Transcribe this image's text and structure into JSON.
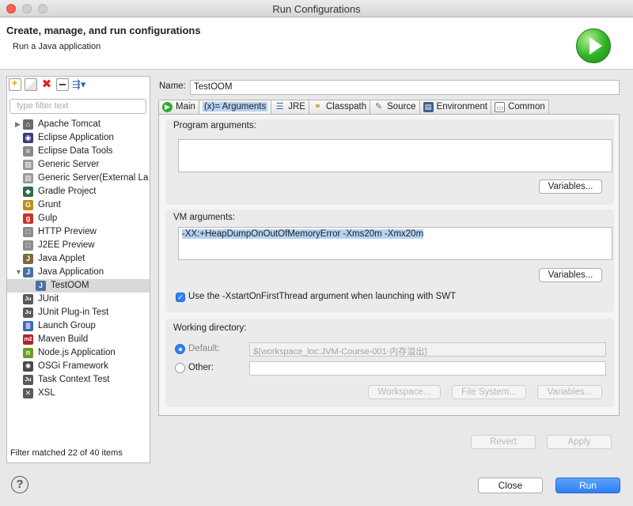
{
  "window": {
    "title": "Run Configurations"
  },
  "header": {
    "title": "Create, manage, and run configurations",
    "subtitle": "Run a Java application"
  },
  "left_panel": {
    "filter_placeholder": "type filter text",
    "items": [
      {
        "label": "Apache Tomcat",
        "icon": "tomcat-icon",
        "twisty": "▶"
      },
      {
        "label": "Eclipse Application",
        "icon": "eclipse-icon"
      },
      {
        "label": "Eclipse Data Tools",
        "icon": "database-icon"
      },
      {
        "label": "Generic Server",
        "icon": "server-icon"
      },
      {
        "label": "Generic Server(External La",
        "icon": "server-icon"
      },
      {
        "label": "Gradle Project",
        "icon": "gradle-icon"
      },
      {
        "label": "Grunt",
        "icon": "grunt-icon"
      },
      {
        "label": "Gulp",
        "icon": "gulp-icon"
      },
      {
        "label": "HTTP Preview",
        "icon": "http-icon"
      },
      {
        "label": "J2EE Preview",
        "icon": "j2ee-icon"
      },
      {
        "label": "Java Applet",
        "icon": "applet-icon"
      },
      {
        "label": "Java Application",
        "icon": "java-app-icon",
        "twisty": "▼"
      },
      {
        "label": "TestOOM",
        "icon": "java-app-icon",
        "child": true,
        "selected": true
      },
      {
        "label": "JUnit",
        "icon": "junit-icon"
      },
      {
        "label": "JUnit Plug-in Test",
        "icon": "junit-icon"
      },
      {
        "label": "Launch Group",
        "icon": "launch-group-icon"
      },
      {
        "label": "Maven Build",
        "icon": "maven-icon"
      },
      {
        "label": "Node.js Application",
        "icon": "nodejs-icon"
      },
      {
        "label": "OSGi Framework",
        "icon": "osgi-icon"
      },
      {
        "label": "Task Context Test",
        "icon": "junit-icon"
      },
      {
        "label": "XSL",
        "icon": "xsl-icon"
      }
    ],
    "status": "Filter matched 22 of 40 items"
  },
  "config": {
    "name_label": "Name:",
    "name_value": "TestOOM",
    "tabs": [
      {
        "label": "Main",
        "icon": "main-icon"
      },
      {
        "label": "(x)= Arguments",
        "icon": "arguments-icon",
        "active": true
      },
      {
        "label": "JRE",
        "icon": "jre-icon"
      },
      {
        "label": "Classpath",
        "icon": "classpath-icon"
      },
      {
        "label": "Source",
        "icon": "source-icon"
      },
      {
        "label": "Environment",
        "icon": "environment-icon"
      },
      {
        "label": "Common",
        "icon": "common-icon"
      }
    ],
    "program_args_label": "Program arguments:",
    "program_args_value": "",
    "variables_label": "Variables...",
    "vm_args_label": "VM arguments:",
    "vm_args_value": "-XX:+HeapDumpOnOutOfMemoryError -Xms20m -Xmx20m",
    "xstart_label": "Use the -XstartOnFirstThread argument when launching with SWT",
    "xstart_checked": true,
    "working_dir_label": "Working directory:",
    "default_label": "Default:",
    "default_value": "${workspace_loc:JVM-Course-001-内存溢出}",
    "other_label": "Other:",
    "other_value": "",
    "workspace_label": "Workspace...",
    "filesystem_label": "File System...",
    "revert_label": "Revert",
    "apply_label": "Apply"
  },
  "footer": {
    "help_icon": "help-icon",
    "close_label": "Close",
    "run_label": "Run"
  },
  "colors": {
    "accent": "#2f7ff7",
    "selection": "#b5d2f3",
    "close": "#fc5f57"
  }
}
